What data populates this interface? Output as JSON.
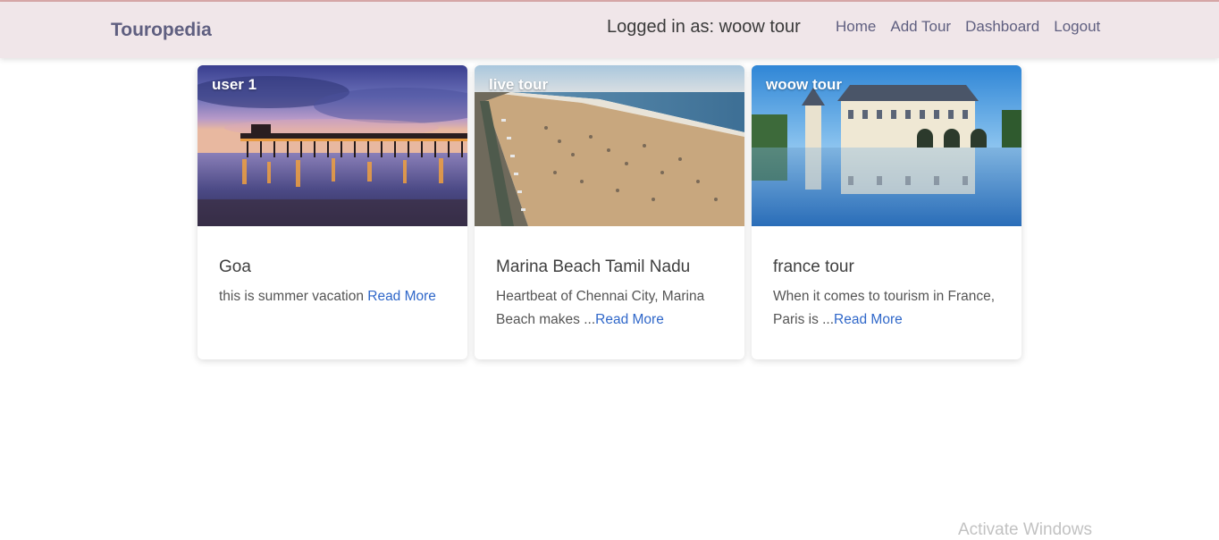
{
  "navbar": {
    "brand": "Touropedia",
    "logged_in_text": "Logged in as: woow tour",
    "links": [
      "Home",
      "Add Tour",
      "Dashboard",
      "Logout"
    ]
  },
  "cards": [
    {
      "user": "user 1",
      "title": "Goa",
      "excerpt": "this is summer vacation ",
      "read_more": "Read More",
      "image": "beach-pier-sunset-image"
    },
    {
      "user": "live tour",
      "title": "Marina Beach Tamil Nadu",
      "excerpt": "Heartbeat of Chennai City, Marina Beach makes ...",
      "read_more": "Read More",
      "image": "aerial-beach-image"
    },
    {
      "user": "woow tour",
      "title": "france tour",
      "excerpt": "When it comes to tourism in France, Paris is ...",
      "read_more": "Read More",
      "image": "french-chateau-reflection-image"
    }
  ],
  "watermark": "Activate Windows"
}
